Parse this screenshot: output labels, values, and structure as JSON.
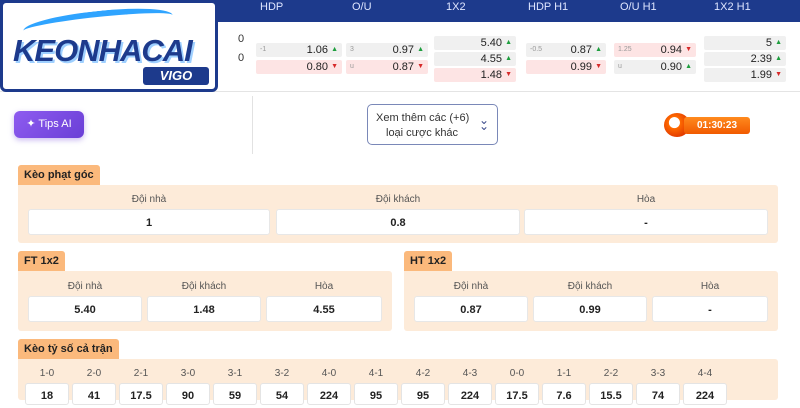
{
  "header": {
    "columns": [
      "HDP",
      "O/U",
      "1X2",
      "HDP H1",
      "O/U H1",
      "1X2 H1"
    ]
  },
  "scores": [
    "0",
    "0"
  ],
  "odds": {
    "hdp": [
      {
        "handicap": "-1",
        "value": "1.06",
        "dir": "up",
        "tone": "gray"
      },
      {
        "handicap": "",
        "value": "0.80",
        "dir": "down",
        "tone": "red"
      }
    ],
    "ou": [
      {
        "handicap": "3",
        "value": "0.97",
        "dir": "up",
        "tone": "gray"
      },
      {
        "handicap": "u",
        "value": "0.87",
        "dir": "down",
        "tone": "red"
      }
    ],
    "x12": [
      {
        "value": "5.40",
        "dir": "up",
        "tone": "gray"
      },
      {
        "value": "4.55",
        "dir": "up",
        "tone": "gray"
      },
      {
        "value": "1.48",
        "dir": "down",
        "tone": "red"
      }
    ],
    "hdp_h1": [
      {
        "handicap": "-0.5",
        "value": "0.87",
        "dir": "up",
        "tone": "gray"
      },
      {
        "handicap": "",
        "value": "0.99",
        "dir": "down",
        "tone": "red"
      }
    ],
    "ou_h1": [
      {
        "handicap": "1.25",
        "value": "0.94",
        "dir": "down",
        "tone": "red"
      },
      {
        "handicap": "u",
        "value": "0.90",
        "dir": "up",
        "tone": "gray"
      }
    ],
    "x12_h1": [
      {
        "value": "5",
        "dir": "up",
        "tone": "gray"
      },
      {
        "value": "2.39",
        "dir": "up",
        "tone": "gray"
      },
      {
        "value": "1.99",
        "dir": "down",
        "tone": "gray"
      }
    ]
  },
  "logo": {
    "text": "KEONHACAI",
    "sub": "VIGO"
  },
  "tips_button": {
    "label": "Tips AI",
    "icon": "sparkle-icon"
  },
  "more_button": {
    "line1": "Xem thêm các (+6)",
    "line2": "loại cược khác",
    "icon": "double-chevron-down-icon"
  },
  "timer": {
    "time": "01:30:23",
    "icon": "fire-ball-icon"
  },
  "corner": {
    "title": "Kèo phạt góc",
    "labels": [
      "Đội nhà",
      "Đội khách",
      "Hòa"
    ],
    "values": [
      "1",
      "0.8",
      "-"
    ]
  },
  "ft": {
    "title": "FT 1x2",
    "labels": [
      "Đội nhà",
      "Đội khách",
      "Hòa"
    ],
    "values": [
      "5.40",
      "1.48",
      "4.55"
    ]
  },
  "ht": {
    "title": "HT 1x2",
    "labels": [
      "Đội nhà",
      "Đội khách",
      "Hòa"
    ],
    "values": [
      "0.87",
      "0.99",
      "-"
    ]
  },
  "correct_score": {
    "title": "Kèo tỷ số cả trận",
    "scores": [
      "1-0",
      "2-0",
      "2-1",
      "3-0",
      "3-1",
      "3-2",
      "4-0",
      "4-1",
      "4-2",
      "4-3",
      "0-0",
      "1-1",
      "2-2",
      "3-3",
      "4-4"
    ],
    "odds": [
      "18",
      "41",
      "17.5",
      "90",
      "59",
      "54",
      "224",
      "95",
      "95",
      "224",
      "17.5",
      "7.6",
      "15.5",
      "74",
      "224"
    ]
  },
  "colors": {
    "header": "#1d3a8c",
    "section": "#fbb97c",
    "panel": "#fdebd9",
    "up": "#1e9e3e",
    "down": "#d62a2a"
  }
}
